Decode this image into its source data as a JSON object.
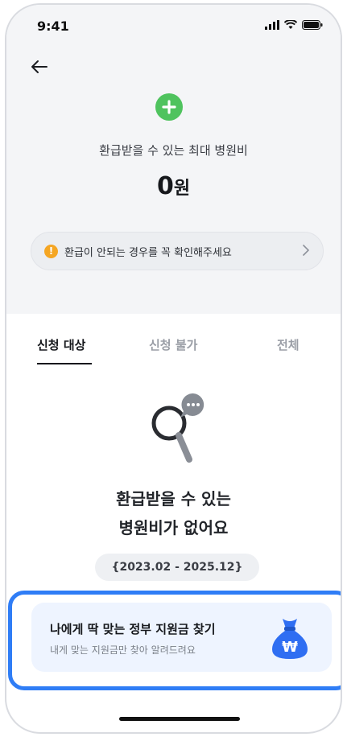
{
  "status_bar": {
    "time": "9:41"
  },
  "header": {
    "headline": "환급받을 수 있는 최대 병원비",
    "amount_value": "0",
    "amount_unit": "원"
  },
  "notice": {
    "text": "환급이 안되는 경우를 꼭 확인해주세요"
  },
  "tabs": [
    {
      "label": "신청 대상",
      "active": true
    },
    {
      "label": "신청 불가",
      "active": false
    },
    {
      "label": "전체",
      "active": false
    }
  ],
  "empty_state": {
    "line1": "환급받을 수 있는",
    "line2": "병원비가 없어요",
    "period": "{2023.02 - 2025.12}"
  },
  "promo": {
    "title": "나에게 딱 맞는 정부 지원금 찾기",
    "subtitle": "내게 맞는 지원금만 찾아 알려드려요",
    "icon_symbol": "₩"
  },
  "colors": {
    "accent_green": "#4fc35e",
    "warning": "#f5a623",
    "promo_blue": "#2f7df6",
    "money_bag": "#2f6ef2"
  },
  "icons": [
    "back-arrow-icon",
    "plus-icon",
    "warning-icon",
    "chevron-right-icon",
    "search-chat-icon",
    "money-bag-icon"
  ]
}
